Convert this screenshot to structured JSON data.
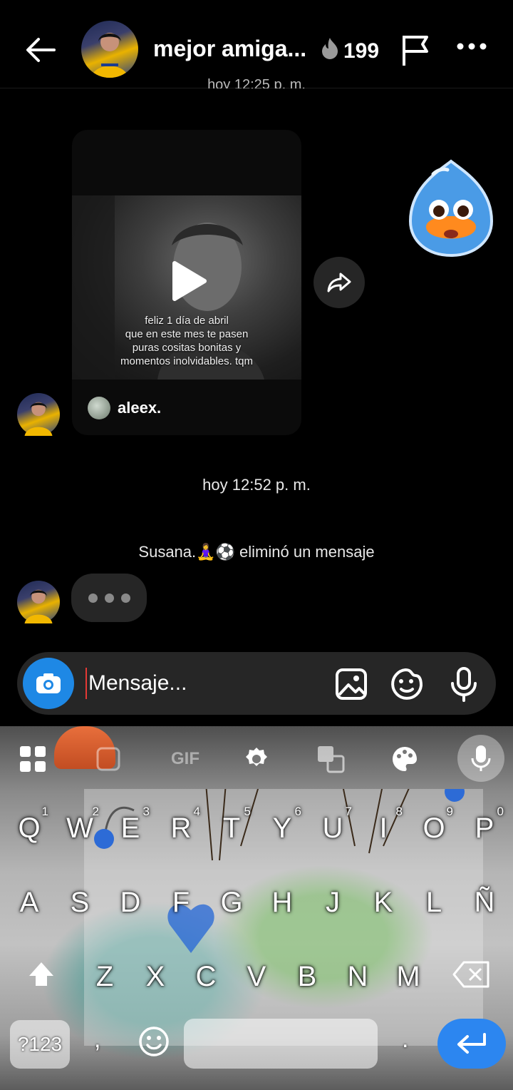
{
  "header": {
    "title": "mejor amiga...",
    "streak_count": "199"
  },
  "chat": {
    "timestamp_top": "hoy 12:25 p. m.",
    "reel": {
      "caption": "feliz 1 día de abril\nque en este mes te pasen\npuras cositas bonitas y\nmomentos inolvidables. tqm",
      "author": "aleex."
    },
    "timestamp": "hoy 12:52 p. m.",
    "system_message": "Susana.🧘‍♀️⚽ eliminó un mensaje"
  },
  "composer": {
    "placeholder": "Mensaje..."
  },
  "keyboard": {
    "rows": [
      [
        {
          "k": "Q",
          "n": "1"
        },
        {
          "k": "W",
          "n": "2"
        },
        {
          "k": "E",
          "n": "3"
        },
        {
          "k": "R",
          "n": "4"
        },
        {
          "k": "T",
          "n": "5"
        },
        {
          "k": "Y",
          "n": "6"
        },
        {
          "k": "U",
          "n": "7"
        },
        {
          "k": "I",
          "n": "8"
        },
        {
          "k": "O",
          "n": "9"
        },
        {
          "k": "P",
          "n": "0"
        }
      ],
      [
        {
          "k": "A"
        },
        {
          "k": "S"
        },
        {
          "k": "D"
        },
        {
          "k": "F"
        },
        {
          "k": "G"
        },
        {
          "k": "H"
        },
        {
          "k": "J"
        },
        {
          "k": "K"
        },
        {
          "k": "L"
        },
        {
          "k": "Ñ"
        }
      ],
      [
        {
          "k": "Z"
        },
        {
          "k": "X"
        },
        {
          "k": "C"
        },
        {
          "k": "V"
        },
        {
          "k": "B"
        },
        {
          "k": "N"
        },
        {
          "k": "M"
        }
      ]
    ],
    "symbols_label": "?123",
    "comma": ",",
    "period": ".",
    "toolbar_gif": "GIF"
  }
}
